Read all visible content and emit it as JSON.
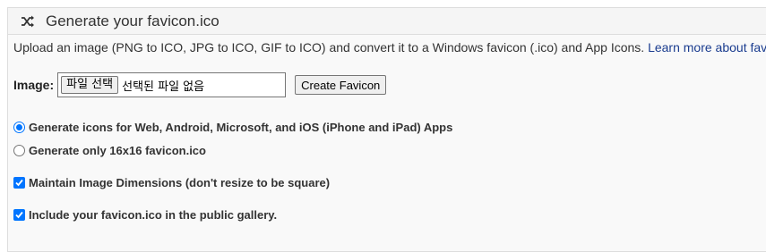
{
  "header": {
    "icon": "shuffle-icon",
    "title": "Generate your favicon.ico"
  },
  "intro": {
    "text": "Upload an image (PNG to ICO, JPG to ICO, GIF to ICO) and convert it to a Windows favicon (.ico) and App Icons. ",
    "link": "Learn more about favicons."
  },
  "upload": {
    "label": "Image:",
    "file_button": "파일 선택",
    "file_status": "선택된 파일 없음",
    "create_button": "Create Favicon"
  },
  "options": {
    "radio_all": {
      "label": "Generate icons for Web, Android, Microsoft, and iOS (iPhone and iPad) Apps",
      "checked": true
    },
    "radio_16": {
      "label": "Generate only 16x16 favicon.ico",
      "checked": false
    },
    "maintain": {
      "label": "Maintain Image Dimensions (don't resize to be square)",
      "checked": true
    },
    "gallery": {
      "label": "Include your favicon.ico in the public gallery.",
      "checked": true
    }
  },
  "colors": {
    "accent": "#0075ff",
    "link": "#1a3c8f"
  }
}
